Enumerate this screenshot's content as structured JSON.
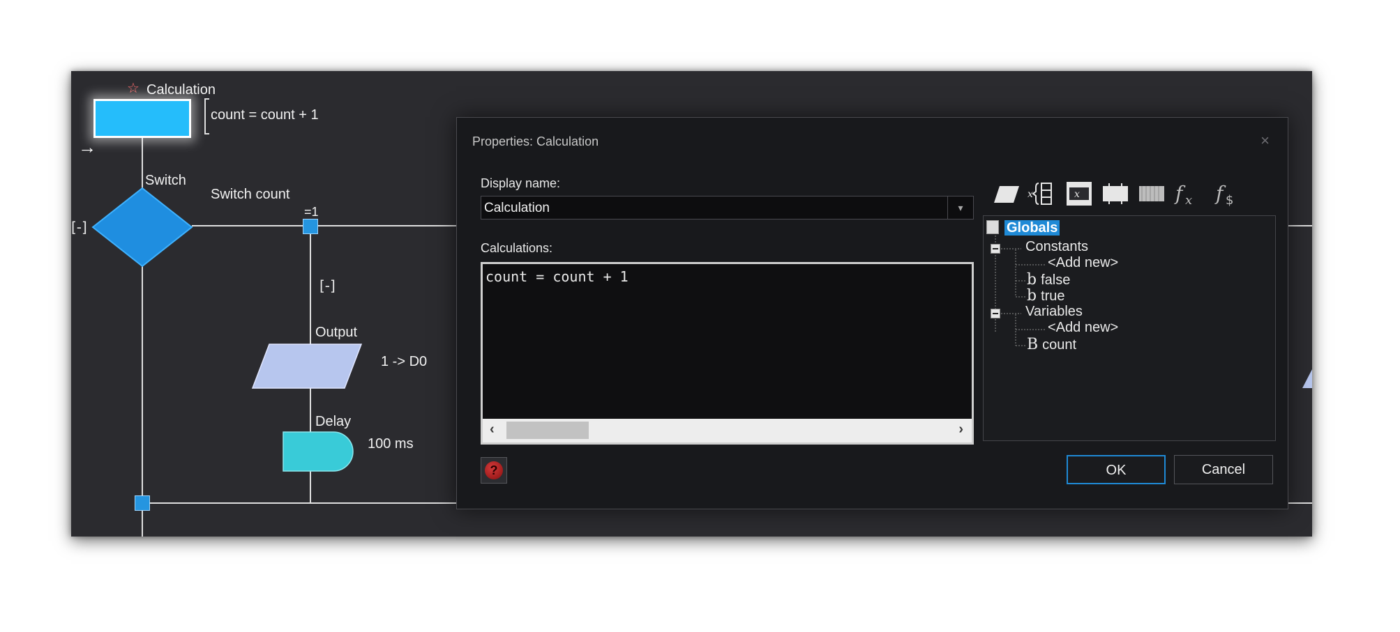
{
  "flowchart": {
    "calc_title": "Calculation",
    "calc_expr": "count = count + 1",
    "switch_title": "Switch",
    "switch_label": "Switch count",
    "case_value": "=1",
    "collapse_left": "[-]",
    "collapse_case": "[-]",
    "output_title": "Output",
    "output_expr": "1 -> D0",
    "delay_title": "Delay",
    "delay_value": "100 ms"
  },
  "dialog": {
    "title": "Properties: Calculation",
    "display_name_label": "Display name:",
    "display_name_value": "Calculation",
    "calculations_label": "Calculations:",
    "calculations_text": "count = count + 1",
    "toolbar_icons": [
      "io-icon",
      "variable-expand-icon",
      "variable-icon",
      "port-icon",
      "array-icon",
      "function-icon",
      "string-function-icon"
    ],
    "tree": {
      "root": "Globals",
      "constants_label": "Constants",
      "constants_add": "<Add new>",
      "const_items": [
        "false",
        "true"
      ],
      "variables_label": "Variables",
      "variables_add": "<Add new>",
      "var_items": [
        "count"
      ]
    },
    "ok_label": "OK",
    "cancel_label": "Cancel",
    "close_glyph": "×"
  }
}
